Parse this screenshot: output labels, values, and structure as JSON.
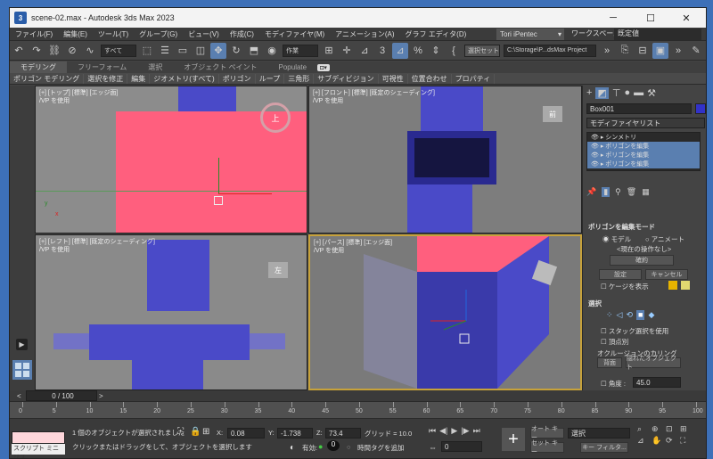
{
  "window": {
    "title": "scene-02.max - Autodesk 3ds Max 2023",
    "minimize": "─",
    "maximize": "☐",
    "close": "✕"
  },
  "menu": [
    "ファイル(F)",
    "編集(E)",
    "ツール(T)",
    "グループ(G)",
    "ビュー(V)",
    "作成(C)",
    "モディファイヤ(M)",
    "アニメーション(A)",
    "グラフ エディタ(D)"
  ],
  "user": {
    "name": "Tori iPentec",
    "workspace_label": "ワークスペース:",
    "workspace_value": "既定値"
  },
  "toolbar": {
    "selection_filter": "すべて",
    "coord_dropdown": "作業",
    "sel_set": "選択セット",
    "path": "C:\\Storage\\P...dsMax Project"
  },
  "ribbon_tabs": [
    "モデリング",
    "フリーフォーム",
    "選択",
    "オブジェクト ペイント",
    "Populate"
  ],
  "ribbon_items": [
    "ポリゴン モデリング",
    "選択を修正",
    "編集",
    "ジオメトリ(すべて)",
    "ポリゴン",
    "ループ",
    "三角形",
    "サブディビジョン",
    "可視性",
    "位置合わせ",
    "プロパティ"
  ],
  "viewports": {
    "top": {
      "label": "[+] [トップ] [標準] [エッジ面]",
      "sub": "/VP を使用",
      "cube": "上"
    },
    "front": {
      "label": "[+] [フロント] [標準] [既定のシェーディング]",
      "sub": "/VP を使用",
      "cube": "前"
    },
    "left": {
      "label": "[+] [レフト] [標準] [既定のシェーディング]",
      "sub": "/VP を使用",
      "cube": "左"
    },
    "persp": {
      "label": "[+] [パース] [標準] [エッジ面]",
      "sub": "/VP を使用"
    }
  },
  "axis": {
    "x": "x",
    "y": "y",
    "z": "z"
  },
  "command_panel": {
    "object_name": "Box001",
    "modifier_list": "モディファイヤリスト",
    "stack": [
      "シンメトリ",
      "ポリゴンを編集",
      "ポリゴンを編集",
      "ポリゴンを編集"
    ],
    "edit_mode_title": "ポリゴンを編集モード",
    "model": "モデル",
    "animate": "アニメート",
    "current_op": "<現在の操作なし>",
    "commit": "確約",
    "settings": "設定",
    "cancel": "キャンセル",
    "show_cage": "ケージを表示",
    "select_title": "選択",
    "by_vertex": "スタック選択を使用",
    "by_vertex2": "頂点別",
    "occlusion_title": "オクルージョンのカリング",
    "backface": "背面",
    "occluded": "隠れたオブジェクト",
    "by_angle": "角度 :",
    "angle_value": "45.0"
  },
  "timeline": {
    "frame": "0 / 100",
    "ticks": [
      "0",
      "5",
      "10",
      "15",
      "20",
      "25",
      "30",
      "35",
      "40",
      "45",
      "50",
      "55",
      "60",
      "65",
      "70",
      "75",
      "80",
      "85",
      "90",
      "95",
      "100"
    ]
  },
  "status": {
    "maxscript": "スクリプト ミニ リス",
    "selected": "1 個のオブジェクトが選択されました",
    "prompt": "クリックまたはドラッグをして、オブジェクトを選択します",
    "x_label": "X:",
    "x_value": "0.08",
    "y_label": "Y:",
    "y_value": "-1.738",
    "z_label": "Z:",
    "z_value": "73.4",
    "grid": "グリッド = 10.0",
    "enabled": "有効:",
    "add_tag": "時間タグを追加",
    "auto_key": "オート キー",
    "set_key": "セット キー",
    "selection": "選択",
    "key_filters": "キー フィルタ...",
    "frame_value": "0"
  },
  "colors": {
    "accent": "#5a7fb0",
    "pink": "#ff5f7e",
    "blue": "#4a4ac8",
    "selected_vp": "#c7a23a"
  }
}
